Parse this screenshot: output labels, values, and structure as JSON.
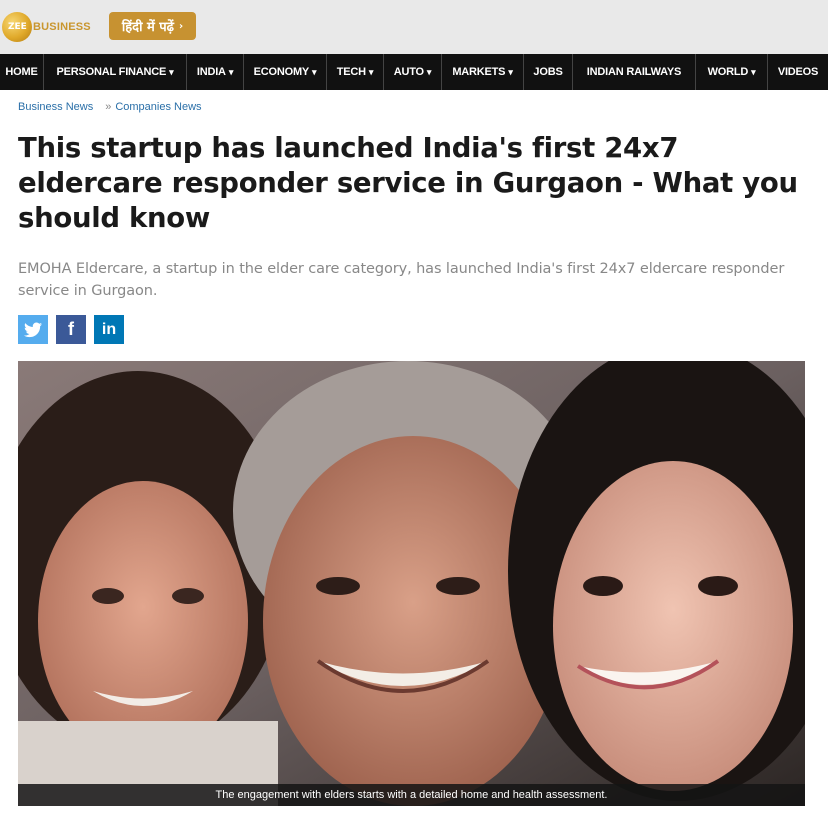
{
  "brand": {
    "logo_small": "ZEE",
    "logo_text": "BUSINESS"
  },
  "hindi_button": {
    "label": "हिंदी में पढ़ें",
    "chevron": "›"
  },
  "nav": [
    {
      "label": "HOME",
      "dropdown": false
    },
    {
      "label": "PERSONAL FINANCE",
      "dropdown": true
    },
    {
      "label": "INDIA",
      "dropdown": true
    },
    {
      "label": "ECONOMY",
      "dropdown": true
    },
    {
      "label": "TECH",
      "dropdown": true
    },
    {
      "label": "AUTO",
      "dropdown": true
    },
    {
      "label": "MARKETS",
      "dropdown": true
    },
    {
      "label": "JOBS",
      "dropdown": false
    },
    {
      "label": "INDIAN RAILWAYS",
      "dropdown": false
    },
    {
      "label": "WORLD",
      "dropdown": true
    },
    {
      "label": "VIDEOS",
      "dropdown": false
    }
  ],
  "breadcrumb": {
    "first": "Business News",
    "separator": "»",
    "second": "Companies News"
  },
  "article": {
    "headline": "This startup has launched India's first 24x7 eldercare responder service in Gurgaon - What you should know",
    "summary": "EMOHA Eldercare, a startup in the elder care category, has launched India's first 24x7 eldercare responder service in Gurgaon.",
    "image_caption": "The engagement with elders starts with a detailed home and health assessment."
  },
  "share": [
    {
      "network": "twitter",
      "icon": "twitter-icon",
      "glyph": ""
    },
    {
      "network": "facebook",
      "icon": "facebook-icon",
      "glyph": "f"
    },
    {
      "network": "linkedin",
      "icon": "linkedin-icon",
      "glyph": "in"
    }
  ],
  "colors": {
    "topbar_bg": "#e9e9e9",
    "nav_bg": "#111111",
    "hindi_btn": "#c79231",
    "link": "#2a6fa8",
    "twitter": "#55acee",
    "facebook": "#3b5998",
    "linkedin": "#0077b5"
  }
}
